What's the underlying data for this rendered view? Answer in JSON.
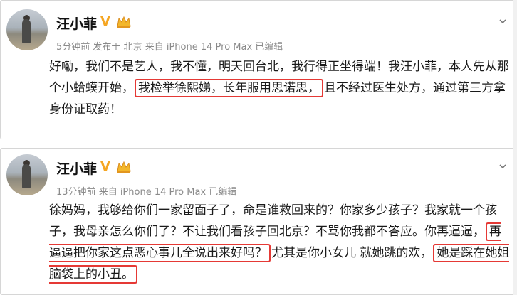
{
  "posts": [
    {
      "author": "汪小菲",
      "time": "5分钟前",
      "location": "发布于 北京",
      "device": "来自 iPhone 14 Pro Max",
      "edited": "已编辑",
      "text_before": "好嘞，我们不是艺人，我不懂，明天回台北，我行得正坐得端！我汪小菲，本人先从那个小蛤蟆开始，",
      "text_highlight": "我检举徐熙娣，长年服用思诺思，",
      "text_after": "且不经过医生处方，通过第三方拿身份证取药！"
    },
    {
      "author": "汪小菲",
      "time": "13分钟前",
      "device": "来自 iPhone 14 Pro Max",
      "edited": "已编辑",
      "text_before": "徐妈妈，我够给你们一家留面子了，命是谁救回来的？你家多少孩子？我家就一个孩子，我母亲怎么你们了？不让我们看孩子回北京？不骂你我都不答应。你再逼逼，",
      "text_highlight": "再逼逼把你家这点恶心事儿全说出来好吗？",
      "text_middle": "尤其是你小女儿 就她跳的欢，",
      "text_highlight2": "她是踩在她姐脑袋上的小丑。"
    }
  ],
  "colors": {
    "highlight_border": "#e53935",
    "meta": "#8a8a8a",
    "vip": "#f5a623"
  },
  "icons": [
    "avatar-photo",
    "verified-v-icon",
    "vip-crown-icon",
    "chevron-down-icon"
  ]
}
